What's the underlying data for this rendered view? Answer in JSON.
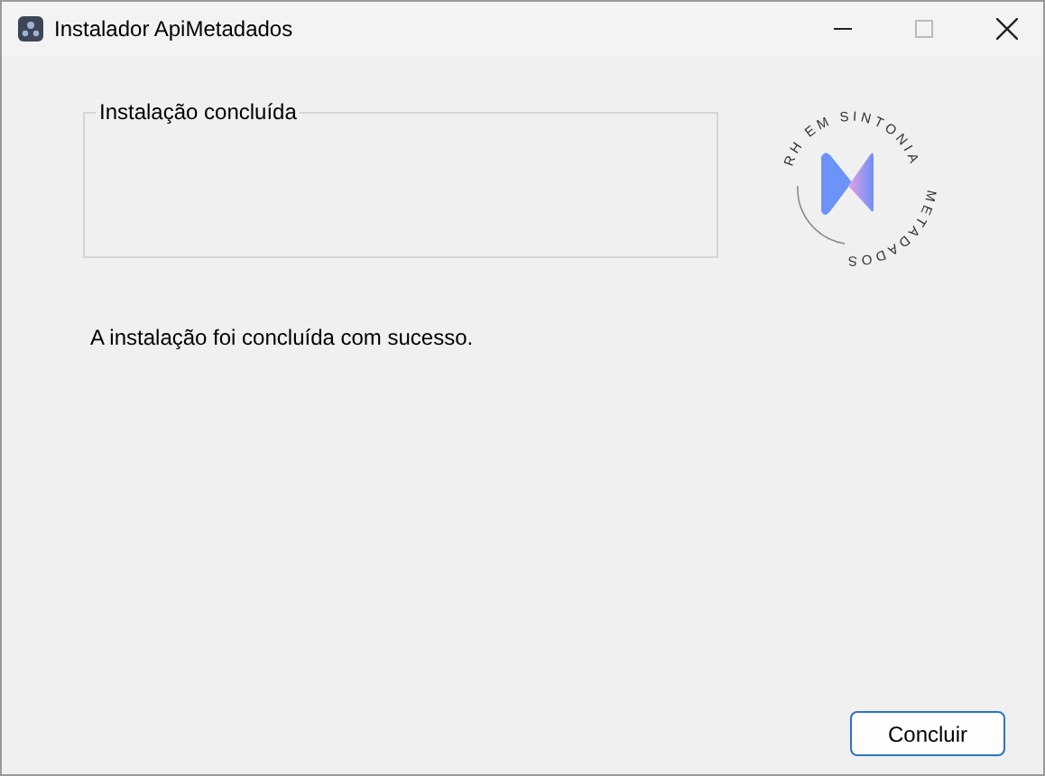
{
  "window": {
    "title": "Instalador ApiMetadados"
  },
  "group": {
    "title": "Instalação concluída"
  },
  "logo": {
    "top_text": "RH EM SINTONIA",
    "bottom_text": "METADADOS"
  },
  "message": "A instalação foi concluída com sucesso.",
  "buttons": [
    {
      "label": "Concluir",
      "selected": true
    }
  ]
}
